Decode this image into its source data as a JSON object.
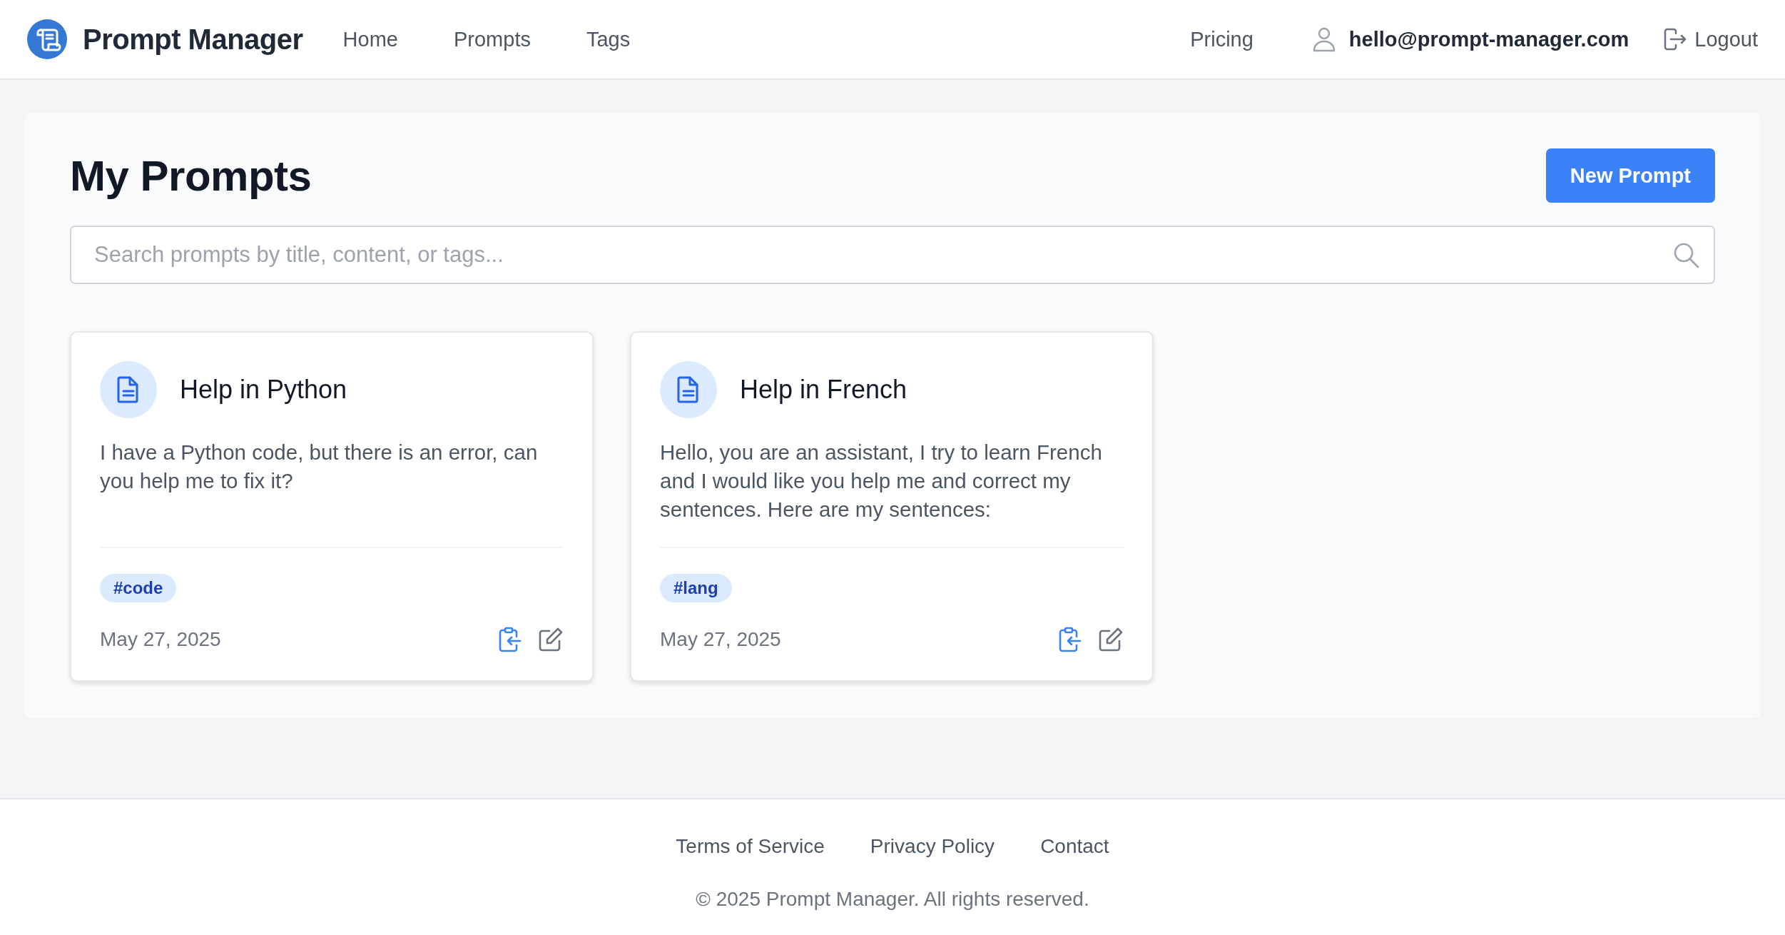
{
  "header": {
    "brand": "Prompt Manager",
    "nav": [
      {
        "label": "Home"
      },
      {
        "label": "Prompts"
      },
      {
        "label": "Tags"
      }
    ],
    "pricing": "Pricing",
    "user_email": "hello@prompt-manager.com",
    "logout": "Logout"
  },
  "page": {
    "title": "My Prompts",
    "new_button": "New Prompt",
    "search": {
      "placeholder": "Search prompts by title, content, or tags..."
    }
  },
  "prompts": [
    {
      "title": "Help in Python",
      "content": "I have a Python code, but there is an error, can you help me to fix it?",
      "tags": [
        "#code"
      ],
      "date": "May 27, 2025"
    },
    {
      "title": "Help in French",
      "content": "Hello, you are an assistant, I try to learn French and I would like you help me and correct my sentences. Here are my sentences:",
      "tags": [
        "#lang"
      ],
      "date": "May 27, 2025"
    }
  ],
  "footer": {
    "links": [
      "Terms of Service",
      "Privacy Policy",
      "Contact"
    ],
    "copyright": "© 2025 Prompt Manager. All rights reserved."
  }
}
